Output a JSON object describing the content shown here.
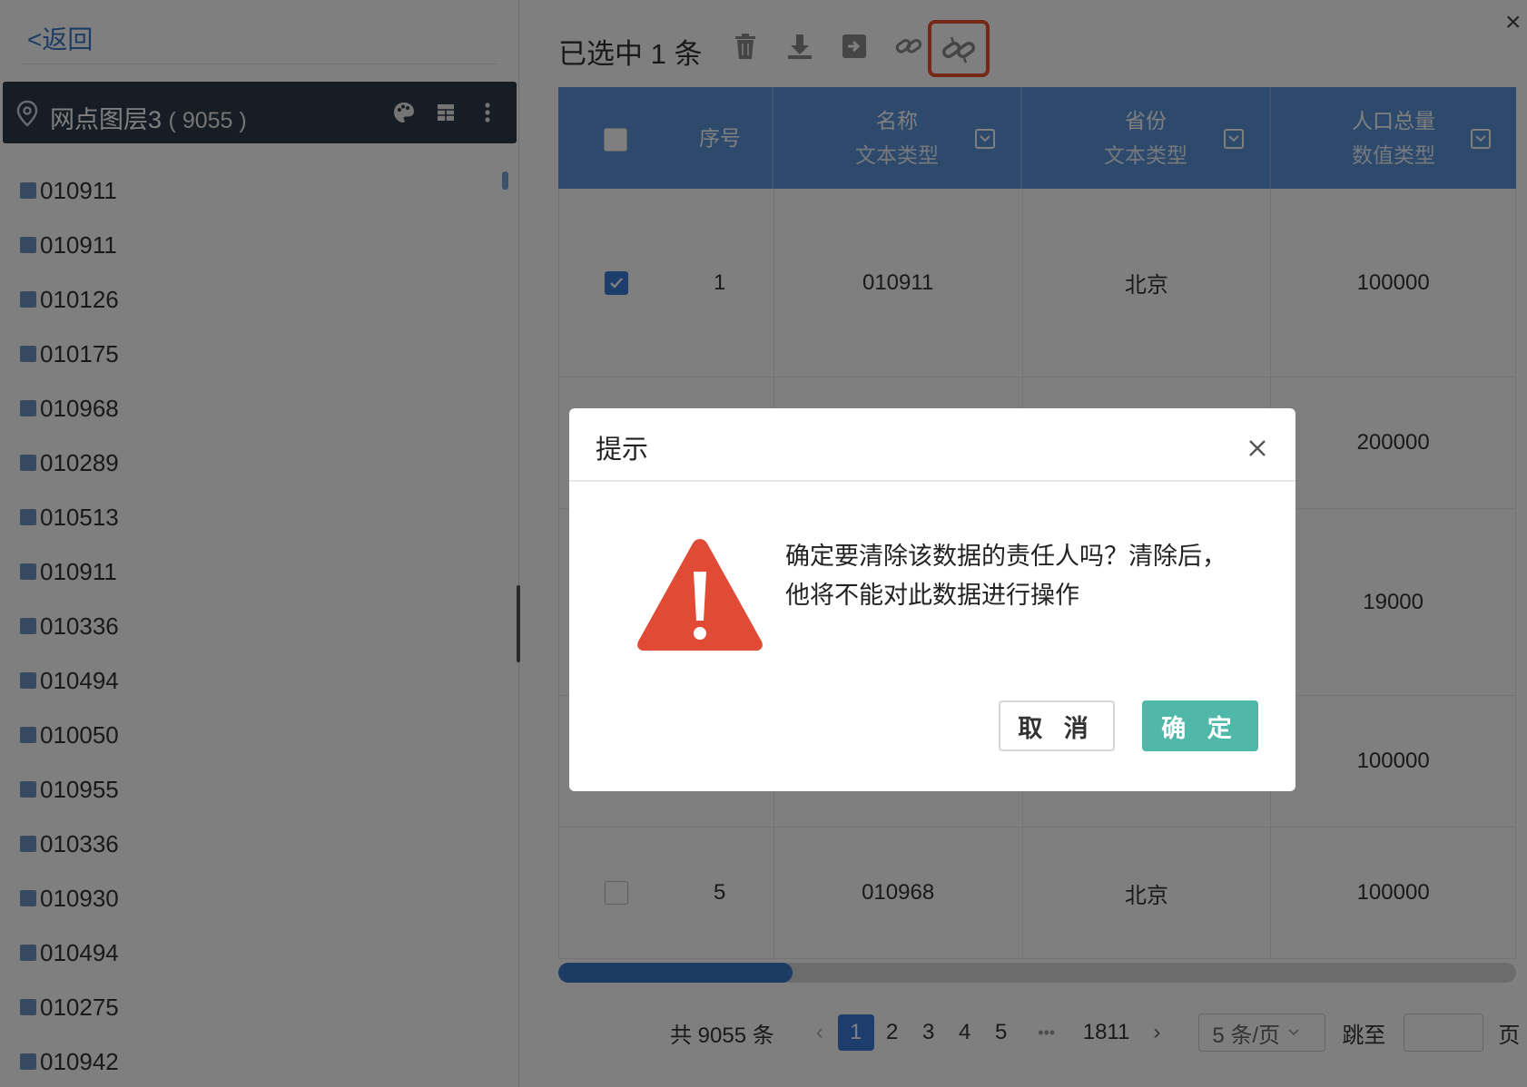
{
  "left_panel": {
    "back_label": "<返回",
    "layer": {
      "name": "网点图层3",
      "count": "( 9055 )"
    },
    "points": [
      "010911",
      "010911",
      "010126",
      "010175",
      "010968",
      "010289",
      "010513",
      "010911",
      "010336",
      "010494",
      "010050",
      "010955",
      "010336",
      "010930",
      "010494",
      "010275",
      "010942"
    ]
  },
  "right_panel": {
    "close_label": "×",
    "selected_text": "已选中 1 条",
    "table": {
      "headers": [
        {
          "label": "序号",
          "sub": ""
        },
        {
          "label": "名称",
          "sub": "文本类型"
        },
        {
          "label": "省份",
          "sub": "文本类型"
        },
        {
          "label": "人口总量",
          "sub": "数值类型"
        }
      ],
      "rows": [
        {
          "checked": true,
          "seq": "1",
          "name": "010911",
          "province": "北京",
          "population": "100000"
        },
        {
          "checked": false,
          "seq": "",
          "name": "",
          "province": "",
          "population": "200000"
        },
        {
          "checked": false,
          "seq": "",
          "name": "",
          "province": "",
          "population": "19000"
        },
        {
          "checked": false,
          "seq": "",
          "name": "",
          "province": "",
          "population": "100000"
        },
        {
          "checked": false,
          "seq": "5",
          "name": "010968",
          "province": "北京",
          "population": "100000"
        }
      ]
    },
    "pagination": {
      "total": "共 9055 条",
      "prev": "‹",
      "pages": [
        "1",
        "2",
        "3",
        "4",
        "5"
      ],
      "ellipsis": "•••",
      "last_page": "1811",
      "next": "›",
      "page_size": "5 条/页",
      "jump_label": "跳至",
      "page_suffix": "页"
    }
  },
  "modal": {
    "title": "提示",
    "message_line1": "确定要清除该数据的责任人吗？清除后，",
    "message_line2": "他将不能对此数据进行操作",
    "cancel_label": "取 消",
    "ok_label": "确 定"
  },
  "colors": {
    "header_blue": "#5a92d6",
    "layer_bar": "#2f3a4a",
    "confirm_green": "#4fb8a8",
    "warning_red": "#e14b36",
    "highlight_orange": "#e8512a"
  }
}
